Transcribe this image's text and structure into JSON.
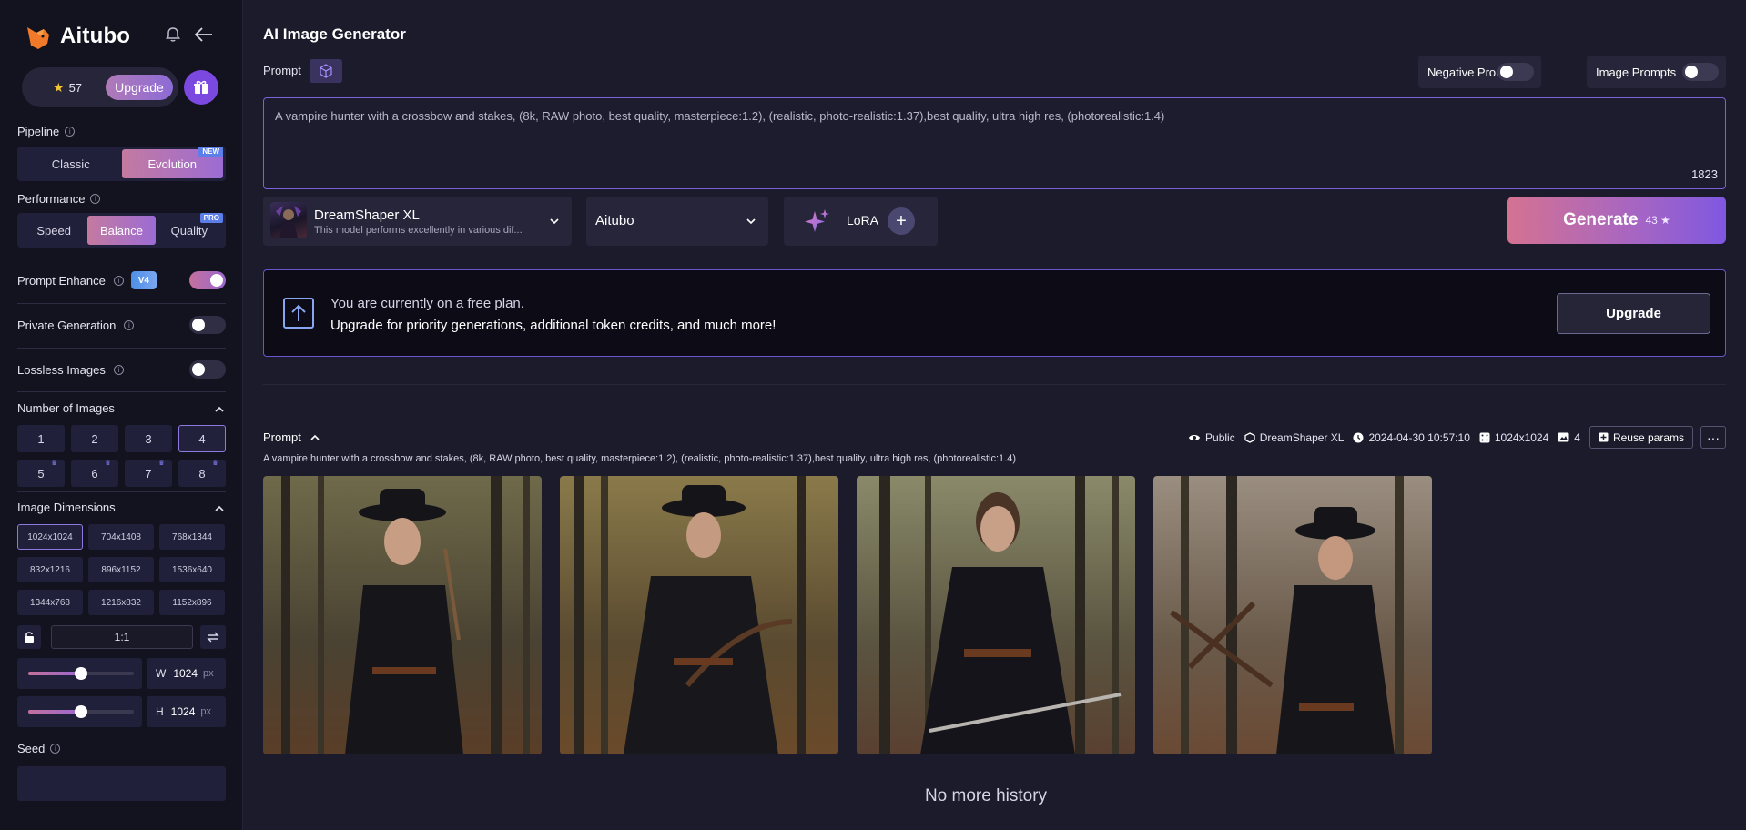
{
  "app": {
    "name": "Aitubo",
    "credits": "57",
    "upgrade_label": "Upgrade"
  },
  "sidebar": {
    "pipeline": {
      "label": "Pipeline",
      "options": [
        "Classic",
        "Evolution"
      ],
      "active": "Evolution",
      "new_tag": "NEW"
    },
    "performance": {
      "label": "Performance",
      "options": [
        "Speed",
        "Balance",
        "Quality"
      ],
      "active": "Balance",
      "pro_tag": "PRO"
    },
    "prompt_enhance": {
      "label": "Prompt Enhance",
      "badge": "V4",
      "on": true
    },
    "private_generation": {
      "label": "Private Generation",
      "on": false
    },
    "lossless_images": {
      "label": "Lossless Images",
      "on": false
    },
    "number_of_images": {
      "label": "Number of Images",
      "options": [
        "1",
        "2",
        "3",
        "4",
        "5",
        "6",
        "7",
        "8"
      ],
      "selected": "4"
    },
    "image_dimensions": {
      "label": "Image Dimensions",
      "options": [
        "1024x1024",
        "704x1408",
        "768x1344",
        "832x1216",
        "896x1152",
        "1536x640",
        "1344x768",
        "1216x832",
        "1152x896"
      ],
      "selected": "1024x1024",
      "ratio": "1:1",
      "width_label": "W",
      "width": "1024",
      "height_label": "H",
      "height": "1024",
      "unit": "px",
      "width_slider_fraction": 0.5,
      "height_slider_fraction": 0.5
    },
    "seed": {
      "label": "Seed",
      "value": ""
    }
  },
  "main": {
    "title": "AI Image Generator",
    "prompt_label": "Prompt",
    "negative_prompt": {
      "label": "Negative Prompt",
      "on": false
    },
    "image_prompts": {
      "label": "Image Prompts",
      "on": false
    },
    "prompt_text": "A vampire hunter with a crossbow and stakes, (8k, RAW photo, best quality, masterpiece:1.2), (realistic, photo-realistic:1.37),best quality, ultra high res, (photorealistic:1.4)",
    "prompt_count": "1823",
    "model": {
      "name": "DreamShaper XL",
      "description": "This model performs excellently in various dif..."
    },
    "style": "Aitubo",
    "lora_label": "LoRA",
    "generate": {
      "label": "Generate",
      "cost": "43"
    },
    "plan_banner": {
      "line1": "You are currently on a free plan.",
      "line2": "Upgrade for priority generations, additional token credits, and much more!",
      "button": "Upgrade"
    },
    "history": {
      "prompt_label": "Prompt",
      "prompt_text": "A vampire hunter with a crossbow and stakes, (8k, RAW photo, best quality, masterpiece:1.2), (realistic, photo-realistic:1.37),best quality, ultra high res, (photorealistic:1.4)",
      "visibility": "Public",
      "model": "DreamShaper XL",
      "datetime": "2024-04-30 10:57:10",
      "size": "1024x1024",
      "count": "4",
      "reuse_label": "Reuse params",
      "images": [
        "vampire-hunter-1",
        "vampire-hunter-2",
        "vampire-hunter-3",
        "vampire-hunter-4"
      ]
    },
    "no_more": "No more history"
  },
  "colors": {
    "accent": "#7b62d8",
    "gradient_start": "#c4709c",
    "gradient_end": "#9a68d0",
    "sidebar_bg": "#13121f",
    "main_bg": "#1c1b2b"
  }
}
